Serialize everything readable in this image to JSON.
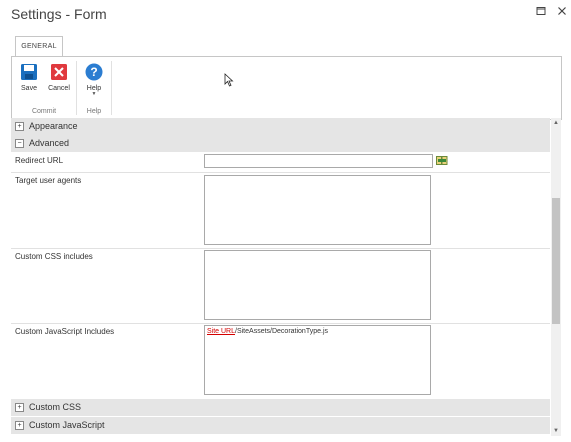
{
  "window": {
    "title": "Settings - Form"
  },
  "ribbon": {
    "tabs": [
      {
        "label": "GENERAL"
      }
    ],
    "groups": [
      {
        "label": "Commit",
        "buttons": [
          {
            "label": "Save",
            "icon": "save-icon"
          },
          {
            "label": "Cancel",
            "icon": "cancel-icon"
          }
        ]
      },
      {
        "label": "Help",
        "buttons": [
          {
            "label": "Help",
            "icon": "help-icon"
          }
        ]
      }
    ]
  },
  "sections": {
    "appearance": {
      "title": "Appearance",
      "state": "collapsed"
    },
    "advanced": {
      "title": "Advanced",
      "state": "expanded"
    },
    "custom_css": {
      "title": "Custom CSS",
      "state": "collapsed"
    },
    "custom_js": {
      "title": "Custom JavaScript",
      "state": "collapsed"
    }
  },
  "fields": {
    "redirect_url": {
      "label": "Redirect URL",
      "value": ""
    },
    "target_user_agents": {
      "label": "Target user agents",
      "value": ""
    },
    "custom_css_includes": {
      "label": "Custom CSS includes",
      "value": ""
    },
    "custom_js_includes": {
      "label": "Custom JavaScript Includes",
      "link_text": "Site URL",
      "path_text": "/SiteAssets/DecorationType.js"
    }
  },
  "colors": {
    "save_blue": "#1a6fbf",
    "cancel_red": "#e0393e",
    "help_blue": "#2b7dd1",
    "link_red": "#d40000"
  }
}
